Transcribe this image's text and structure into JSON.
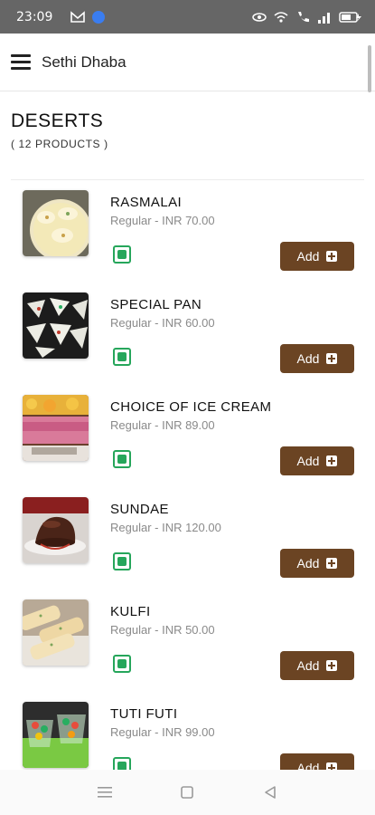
{
  "status_bar": {
    "time": "23:09",
    "icons_left": [
      "gmail-icon",
      "app-notification-icon"
    ],
    "icons_right": [
      "eye-icon",
      "wifi-icon",
      "call-icon",
      "signal-icon",
      "battery-charging-icon"
    ]
  },
  "app_bar": {
    "title": "Sethi Dhaba",
    "menu_icon": "hamburger-menu-icon"
  },
  "category": {
    "title": "DESERTS",
    "count": "( 12 PRODUCTS )"
  },
  "products": [
    {
      "name": "RASMALAI",
      "price": "Regular - INR 70.00",
      "veg": true,
      "add_label": "Add",
      "image": "rasmalai-image"
    },
    {
      "name": "SPECIAL PAN",
      "price": "Regular - INR 60.00",
      "veg": true,
      "add_label": "Add",
      "image": "special-pan-image"
    },
    {
      "name": "CHOICE OF ICE CREAM",
      "price": "Regular - INR 89.00",
      "veg": true,
      "add_label": "Add",
      "image": "ice-cream-image"
    },
    {
      "name": "SUNDAE",
      "price": "Regular - INR 120.00",
      "veg": true,
      "add_label": "Add",
      "image": "sundae-image"
    },
    {
      "name": "KULFI",
      "price": "Regular - INR 50.00",
      "veg": true,
      "add_label": "Add",
      "image": "kulfi-image"
    },
    {
      "name": "TUTI FUTI",
      "price": "Regular - INR 99.00",
      "veg": true,
      "add_label": "Add",
      "image": "tuti-futi-image"
    }
  ],
  "colors": {
    "add_button": "#6b4423",
    "veg_indicator": "#26a65b",
    "status_bar": "#666666"
  },
  "nav_bar": {
    "icons": [
      "recent-apps-icon",
      "home-icon",
      "back-icon"
    ]
  }
}
